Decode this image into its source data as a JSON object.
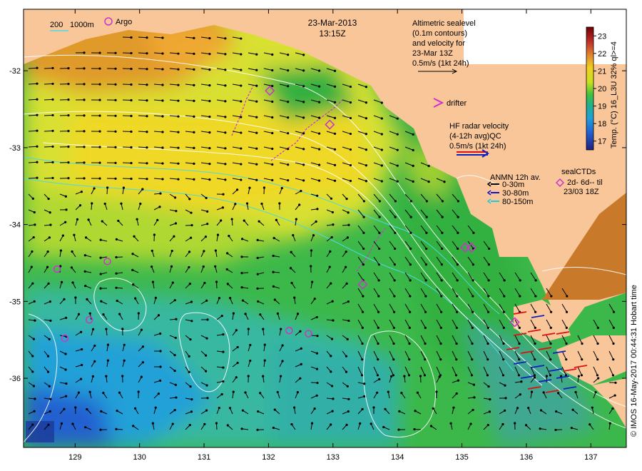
{
  "title": {
    "date": "23-Mar-2013",
    "time": "13:15Z"
  },
  "depth_legend": {
    "label_200": "200",
    "label_1000": "1000m",
    "argo_label": "Argo"
  },
  "altimetry_legend": {
    "line1": "Altimetric sealevel",
    "line2": "(0.1m contours)",
    "line3": "and velocity for",
    "line4": "23-Mar 13Z",
    "line5": "0.5m/s (1kt 24h)"
  },
  "drifter_legend": {
    "label": "drifter"
  },
  "hf_radar_legend": {
    "line1": "HF radar velocity",
    "line2": "(4-12h avg)QC",
    "line3": "0.5m/s (1kt 24h)"
  },
  "anmn_legend": {
    "title": "ANMN 12h av.",
    "items": [
      {
        "label": "0-30m",
        "color": "#000000"
      },
      {
        "label": "30-80m",
        "color": "#1010d0"
      },
      {
        "label": "80-150m",
        "color": "#20c8d8"
      }
    ]
  },
  "sealctd_legend": {
    "title": "sealCTDs",
    "line1": "2d- 6d-- til",
    "line2": "23/03 18Z"
  },
  "colorbar": {
    "ticks": [
      "23",
      "22",
      "21",
      "20",
      "19",
      "18",
      "17"
    ],
    "vmin": 16.5,
    "vmax": 23.5,
    "label": "Temp. (°C) 16_L3U 32% ql>=4"
  },
  "credit": "© IMOS 16-May-2017 00:44:31 Hobart time",
  "axes": {
    "lon_ticks": [
      "129",
      "130",
      "131",
      "132",
      "133",
      "134",
      "135",
      "136",
      "137"
    ],
    "lat_ticks": [
      "-32",
      "-33",
      "-34",
      "-35",
      "-36"
    ],
    "lon_range": [
      128.2,
      137.55
    ],
    "lat_range": [
      -31.2,
      -36.9
    ]
  },
  "argo_floats": [
    {
      "lon": 128.72,
      "lat": -34.58
    },
    {
      "lon": 129.5,
      "lat": -34.48
    },
    {
      "lon": 129.22,
      "lat": -35.24
    },
    {
      "lon": 128.84,
      "lat": -35.48
    },
    {
      "lon": 132.32,
      "lat": -35.38
    },
    {
      "lon": 132.62,
      "lat": -35.42
    }
  ],
  "seal_ctds": [
    {
      "lon": 132.02,
      "lat": -32.26
    },
    {
      "lon": 132.95,
      "lat": -32.7
    },
    {
      "lon": 133.46,
      "lat": -34.78
    },
    {
      "lon": 135.05,
      "lat": -34.3
    },
    {
      "lon": 135.15,
      "lat": -34.3
    },
    {
      "lon": 135.82,
      "lat": -35.27
    }
  ],
  "colors": {
    "land": "#f9c69a",
    "argo": "#cc33cc",
    "seal": "#cc33cc",
    "hf_red": "#e01010",
    "hf_blue": "#1020c0",
    "contour": "#ffffff",
    "isobath": "#4ed8e0"
  }
}
